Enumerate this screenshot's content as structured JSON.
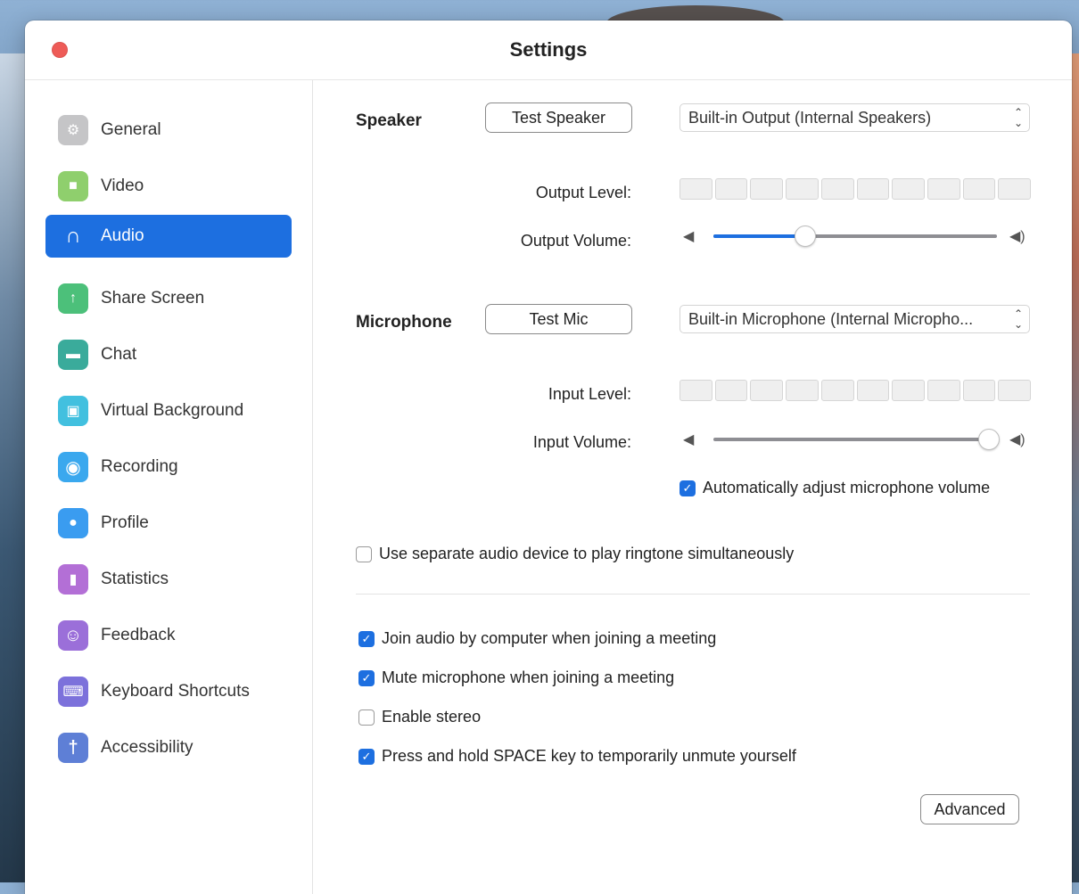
{
  "window": {
    "title": "Settings"
  },
  "sidebar": {
    "items": [
      {
        "label": "General",
        "icon": "gear-icon",
        "color": "#c5c5c7",
        "glyph": "⚙",
        "active": false
      },
      {
        "label": "Video",
        "icon": "video-camera-icon",
        "color": "#8fcf6d",
        "glyph": "■",
        "active": false
      },
      {
        "label": "Audio",
        "icon": "headphones-icon",
        "color": "#1d6fe0",
        "glyph": "∩",
        "active": true
      },
      {
        "label": "Share Screen",
        "icon": "share-screen-icon",
        "color": "#4cc07a",
        "glyph": "↑",
        "active": false
      },
      {
        "label": "Chat",
        "icon": "chat-icon",
        "color": "#3aab9b",
        "glyph": "▬",
        "active": false
      },
      {
        "label": "Virtual Background",
        "icon": "virtual-background-icon",
        "color": "#42c0df",
        "glyph": "▣",
        "active": false
      },
      {
        "label": "Recording",
        "icon": "recording-icon",
        "color": "#3aa8ee",
        "glyph": "◉",
        "active": false
      },
      {
        "label": "Profile",
        "icon": "profile-icon",
        "color": "#3a9cf0",
        "glyph": "●",
        "active": false
      },
      {
        "label": "Statistics",
        "icon": "statistics-icon",
        "color": "#b36fd6",
        "glyph": "▮",
        "active": false
      },
      {
        "label": "Feedback",
        "icon": "feedback-icon",
        "color": "#9b6fd9",
        "glyph": "☺",
        "active": false
      },
      {
        "label": "Keyboard Shortcuts",
        "icon": "keyboard-icon",
        "color": "#7c71db",
        "glyph": "⌨",
        "active": false
      },
      {
        "label": "Accessibility",
        "icon": "accessibility-icon",
        "color": "#5e7fd6",
        "glyph": "†",
        "active": false
      }
    ]
  },
  "speaker": {
    "label": "Speaker",
    "test_button": "Test Speaker",
    "device": "Built-in Output (Internal Speakers)",
    "output_level_label": "Output Level:",
    "output_volume_label": "Output Volume:",
    "volume_fraction": 0.32
  },
  "microphone": {
    "label": "Microphone",
    "test_button": "Test Mic",
    "device": "Built-in Microphone (Internal Micropho...",
    "input_level_label": "Input Level:",
    "input_volume_label": "Input Volume:",
    "volume_fraction": 0.97,
    "auto_adjust_label": "Automatically adjust microphone volume",
    "auto_adjust_checked": true
  },
  "ringtone": {
    "label": "Use separate audio device to play ringtone simultaneously",
    "checked": false
  },
  "options": [
    {
      "label": "Join audio by computer when joining a meeting",
      "checked": true
    },
    {
      "label": "Mute microphone when joining a meeting",
      "checked": true
    },
    {
      "label": "Enable stereo",
      "checked": false
    },
    {
      "label": "Press and hold SPACE key to temporarily unmute yourself",
      "checked": true
    }
  ],
  "advanced_button": "Advanced",
  "colors": {
    "accent": "#1d6fe0",
    "close": "#ee5b57"
  },
  "icons": {
    "chevron": "chevron-updown-icon",
    "volume_low": "speaker-low-icon",
    "volume_high": "speaker-high-icon",
    "check": "checkmark-icon"
  }
}
